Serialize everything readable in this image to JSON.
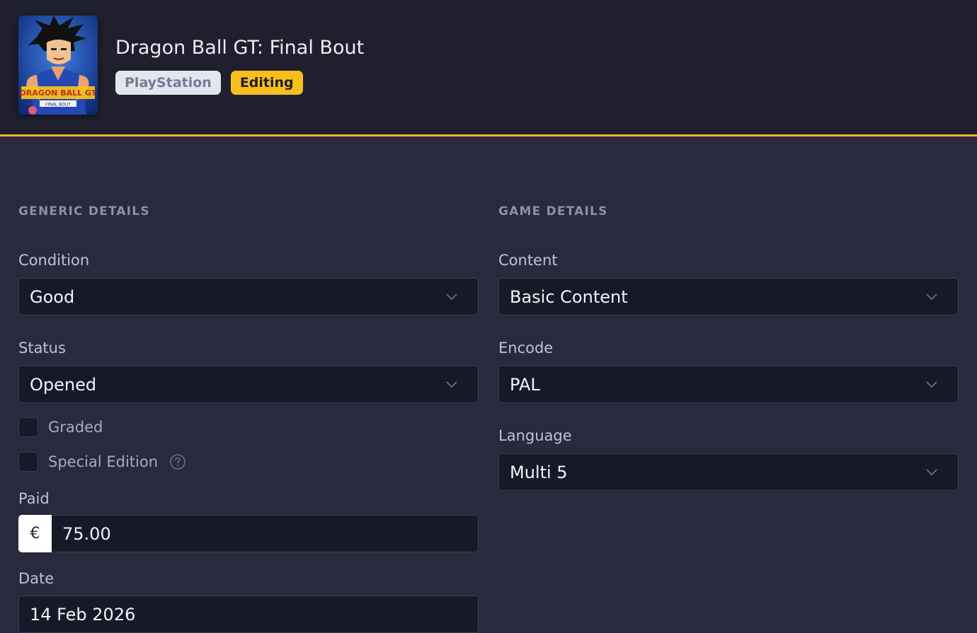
{
  "header": {
    "title": "Dragon Ball GT: Final Bout",
    "cover_text": "DRAGON BALL GT",
    "cover_subtext": "FINAL BOUT",
    "platform_badge": "PlayStation",
    "mode_badge": "Editing",
    "accent_color": "#f0b429"
  },
  "generic": {
    "section_title": "GENERIC DETAILS",
    "condition": {
      "label": "Condition",
      "value": "Good"
    },
    "status": {
      "label": "Status",
      "value": "Opened"
    },
    "graded": {
      "label": "Graded",
      "checked": false
    },
    "special_edition": {
      "label": "Special Edition",
      "checked": false,
      "icon": "help-circle-icon"
    },
    "paid": {
      "label": "Paid",
      "currency": "€",
      "value": "75.00"
    },
    "date": {
      "label": "Date",
      "value": "14 Feb 2026"
    }
  },
  "game": {
    "section_title": "GAME DETAILS",
    "content": {
      "label": "Content",
      "value": "Basic Content"
    },
    "encode": {
      "label": "Encode",
      "value": "PAL"
    },
    "language": {
      "label": "Language",
      "value": "Multi 5"
    }
  }
}
